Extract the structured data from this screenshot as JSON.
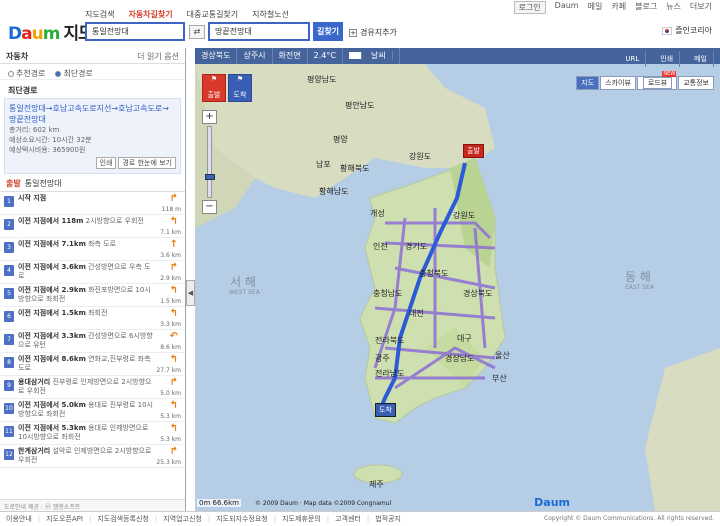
{
  "header": {
    "logo_daum": [
      "D",
      "a",
      "u",
      "m"
    ],
    "title": "지도",
    "nav": [
      "지도검색",
      "자동차길찾기",
      "대중교통길찾기",
      "지하철노선"
    ],
    "active_nav": "자동차길찾기",
    "util": [
      "로그인",
      "Daum",
      "메일",
      "카페",
      "블로그",
      "뉴스",
      "더보기"
    ],
    "from_value": "통일전망대",
    "to_value": "땅끝전망대",
    "swap_icon": "⇄",
    "route_button": "길찾기",
    "waypoint": "경유지추가",
    "region": "즐인코리아"
  },
  "sidebar": {
    "title": "자동차",
    "option_link": "더 읽기 옵션",
    "radios": [
      {
        "label": "추천경로",
        "on": false
      },
      {
        "label": "최단경로",
        "on": true
      }
    ],
    "best_title": "최단경로",
    "route": "통일전망대→호남고속도로지선→호남고속도로→땅끝전망대",
    "stats": [
      "총거리: 602 km",
      "예상소요시간: 10시간 32분",
      "예상택시비용: 365900원"
    ],
    "btns": [
      "인쇄",
      "경로 한눈에 보기"
    ],
    "depart_label": "출발",
    "depart_name": "통일전망대",
    "steps": [
      {
        "num": "1",
        "head": "시작 지점",
        "desc": "",
        "dist": "118 m",
        "arrow": "↱"
      },
      {
        "num": "2",
        "head": "이전 지점에서 118m",
        "desc": "2시방향으로 우회전",
        "dist": "7.1 km",
        "arrow": "↰"
      },
      {
        "num": "3",
        "head": "이전 지점에서 7.1km",
        "desc": "좌측 도로",
        "dist": "3.6 km",
        "arrow": "↑"
      },
      {
        "num": "4",
        "head": "이전 지점에서 3.6km",
        "desc": "간성방면으로 우측 도로",
        "dist": "2.9 km",
        "arrow": "↱"
      },
      {
        "num": "5",
        "head": "이전 지점에서 2.9km",
        "desc": "화진포방면으로 10시방향으로 좌회전",
        "dist": "1.5 km",
        "arrow": "↰"
      },
      {
        "num": "6",
        "head": "이전 지점에서 1.5km",
        "desc": "좌회전",
        "dist": "3.3 km",
        "arrow": "↰"
      },
      {
        "num": "7",
        "head": "이전 지점에서 3.3km",
        "desc": "간성방면으로 6시방향으로 유턴",
        "dist": "8.6 km",
        "arrow": "↶"
      },
      {
        "num": "8",
        "head": "이전 지점에서 8.6km",
        "desc": "연화교,진부령로 좌측 도로",
        "dist": "27.7 km",
        "arrow": "↰"
      },
      {
        "num": "9",
        "head": "용대삼거리",
        "desc": "진부령로 인제방면으로 2시방향으로 우회전",
        "dist": "5.0 km",
        "arrow": "↱"
      },
      {
        "num": "10",
        "head": "이전 지점에서 5.0km",
        "desc": "용대로 진부령로 10시방향으로 좌회전",
        "dist": "5.3 km",
        "arrow": "↰"
      },
      {
        "num": "11",
        "head": "이전 지점에서 5.3km",
        "desc": "용대로 인제방면으로 10시방향으로 좌회전",
        "dist": "5.3 km",
        "arrow": "↰"
      },
      {
        "num": "12",
        "head": "한계삼거리",
        "desc": "설악로 인제방면으로 2시방향으로 우회전",
        "dist": "25.3 km",
        "arrow": "↱"
      }
    ],
    "footer": "도로안내 제공 : ⓜ 엠앤소프트"
  },
  "map": {
    "bar": [
      "경상북도",
      "상주시",
      "화전면",
      "2.4°C",
      "날씨"
    ],
    "bar_right": [
      "URL",
      "인쇄",
      "메일"
    ],
    "types": [
      {
        "label": "지도",
        "on": true
      },
      {
        "label": "스카이뷰",
        "on": false
      },
      {
        "label": "로드뷰",
        "on": false
      },
      {
        "label": "교통정보",
        "on": false
      }
    ],
    "new_badge": "NEW",
    "start_btn": "출발",
    "end_btn": "도착",
    "start_marker": "출발",
    "end_marker": "도착",
    "scale": "66.6km",
    "copyright": "© 2009 Daum · Map data ©2009 Congnamul",
    "labels": [
      "평양남도",
      "평안남도",
      "평양",
      "황해북도",
      "남포",
      "황해남도",
      "강원도",
      "강원도",
      "경기도",
      "인천",
      "개성",
      "충청북도",
      "충청남도",
      "경상북도",
      "대전",
      "전라북도",
      "경상남도",
      "대구",
      "울산",
      "부산",
      "전라남도",
      "광주",
      "제주"
    ],
    "seas": [
      "서 해",
      "WEST SEA",
      "동 해",
      "EAST SEA"
    ],
    "logo": "Daum"
  },
  "footer": {
    "links": [
      "이용안내",
      "지도오픈API",
      "지도검색등록신청",
      "지역업고신청",
      "지도되지수정요청",
      "지도제휴문의",
      "고객센터",
      "법적공지"
    ],
    "copyright": "Copyright © Daum Communications. All rights reserved."
  }
}
